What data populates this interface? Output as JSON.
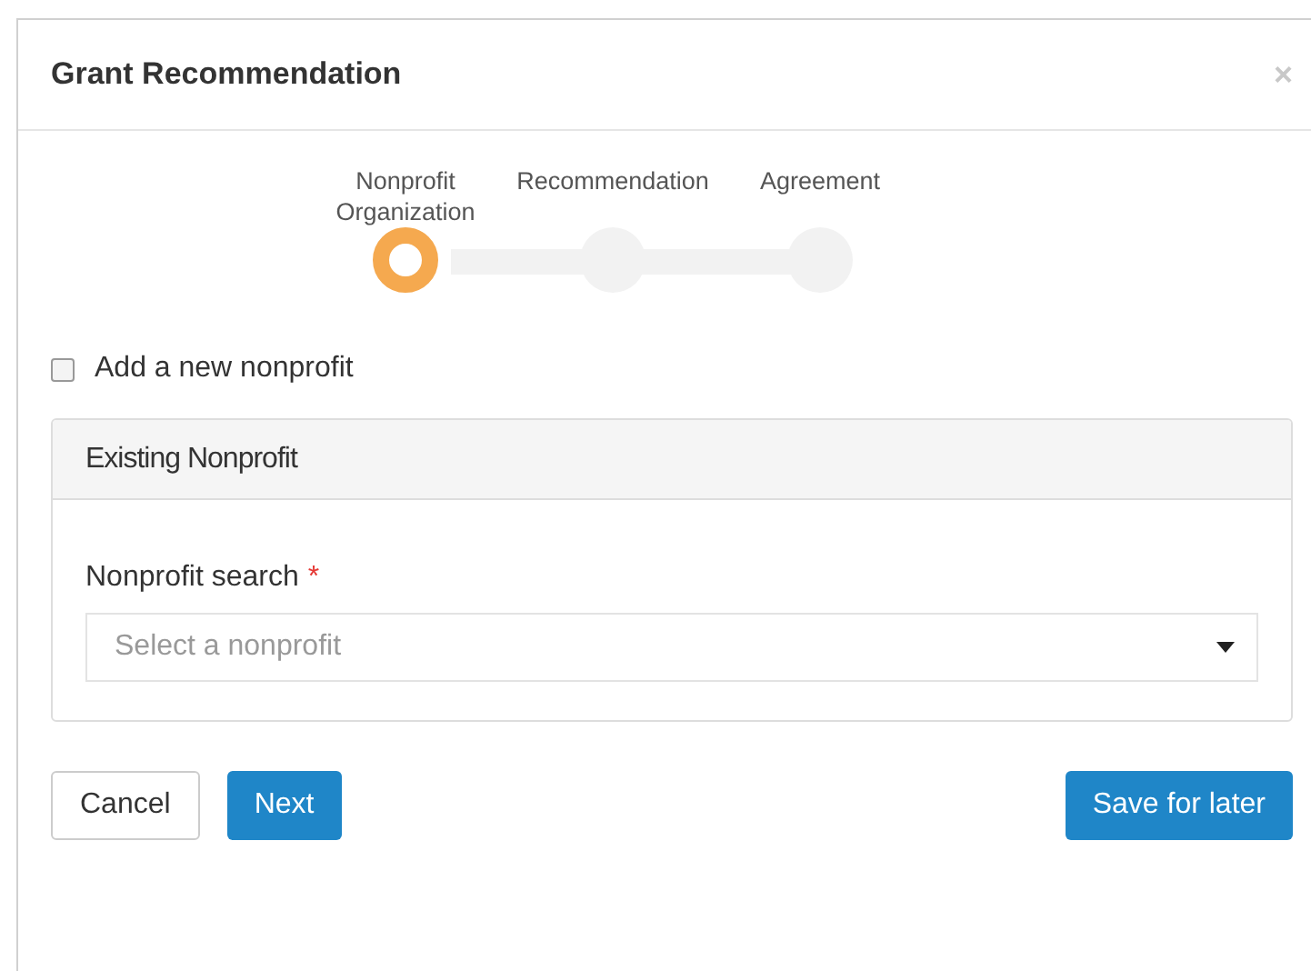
{
  "dialog": {
    "title": "Grant Recommendation",
    "close": "×"
  },
  "steps": [
    {
      "label": "Nonprofit Organization",
      "selected": true
    },
    {
      "label": "Recommendation",
      "selected": false
    },
    {
      "label": "Agreement",
      "selected": false
    }
  ],
  "new_nonprofit": {
    "label": "Add a new nonprofit",
    "checked": false
  },
  "panel": {
    "title": "Existing Nonprofit",
    "field_label": "Nonprofit search",
    "required": "*",
    "placeholder": "Select a nonprofit"
  },
  "buttons": [
    {
      "label": "Cancel",
      "kind": "default"
    },
    {
      "label": "Next",
      "kind": "primary"
    },
    {
      "label": "Save for later",
      "kind": "primary"
    }
  ]
}
